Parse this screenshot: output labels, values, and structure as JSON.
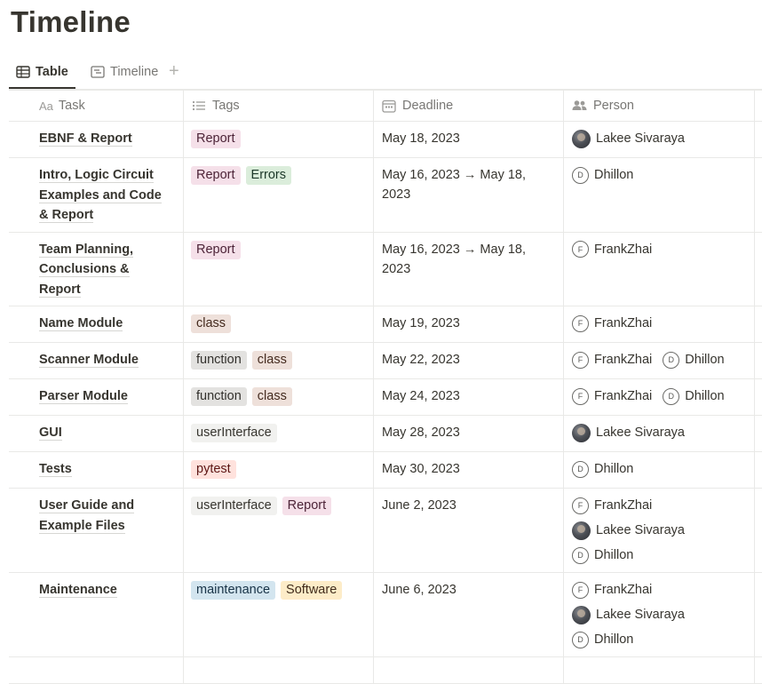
{
  "page": {
    "title": "Timeline"
  },
  "tabs": [
    {
      "label": "Table",
      "icon": "table-icon",
      "active": true
    },
    {
      "label": "Timeline",
      "icon": "timeline-icon",
      "active": false
    }
  ],
  "columns": {
    "task": {
      "label": "Task",
      "icon": "text-property-icon",
      "icon_text": "Aa"
    },
    "tags": {
      "label": "Tags",
      "icon": "multi-select-icon"
    },
    "deadline": {
      "label": "Deadline",
      "icon": "calendar-icon"
    },
    "person": {
      "label": "Person",
      "icon": "people-icon"
    }
  },
  "tag_colors": {
    "Report": {
      "bg": "#f5e0e9",
      "fg": "#4c2337"
    },
    "Errors": {
      "bg": "#dbeddb",
      "fg": "#1c3829"
    },
    "class": {
      "bg": "#eee0da",
      "fg": "#442a1e"
    },
    "function": {
      "bg": "#e3e2e0",
      "fg": "#32302c"
    },
    "userInterface": {
      "bg": "#f1f1ef",
      "fg": "#37352f"
    },
    "pytest": {
      "bg": "#ffe2dd",
      "fg": "#5d1715"
    },
    "maintenance": {
      "bg": "#d3e5ef",
      "fg": "#183347"
    },
    "Software": {
      "bg": "#fdecc8",
      "fg": "#402c1b"
    }
  },
  "rows": [
    {
      "task": "EBNF & Report",
      "tags": [
        "Report"
      ],
      "deadline": "May 18, 2023",
      "people": [
        {
          "name": "Lakee Sivaraya",
          "avatar": "photo"
        }
      ]
    },
    {
      "task": "Intro, Logic Circuit Examples and Code & Report",
      "tags": [
        "Report",
        "Errors"
      ],
      "deadline": "May 16, 2023 → May 18, 2023",
      "people": [
        {
          "name": "Dhillon",
          "avatar": "D"
        }
      ]
    },
    {
      "task": "Team Planning, Conclusions & Report",
      "tags": [
        "Report"
      ],
      "deadline": "May 16, 2023 → May 18, 2023",
      "people": [
        {
          "name": "FrankZhai",
          "avatar": "F"
        }
      ]
    },
    {
      "task": "Name Module",
      "tags": [
        "class"
      ],
      "deadline": "May 19, 2023",
      "people": [
        {
          "name": "FrankZhai",
          "avatar": "F"
        }
      ]
    },
    {
      "task": "Scanner Module",
      "tags": [
        "function",
        "class"
      ],
      "deadline": "May 22, 2023",
      "people": [
        {
          "name": "FrankZhai",
          "avatar": "F"
        },
        {
          "name": "Dhillon",
          "avatar": "D"
        }
      ]
    },
    {
      "task": "Parser Module",
      "tags": [
        "function",
        "class"
      ],
      "deadline": "May 24, 2023",
      "people": [
        {
          "name": "FrankZhai",
          "avatar": "F"
        },
        {
          "name": "Dhillon",
          "avatar": "D"
        }
      ]
    },
    {
      "task": "GUI",
      "tags": [
        "userInterface"
      ],
      "deadline": "May 28, 2023",
      "people": [
        {
          "name": "Lakee Sivaraya",
          "avatar": "photo"
        }
      ]
    },
    {
      "task": "Tests",
      "tags": [
        "pytest"
      ],
      "deadline": "May 30, 2023",
      "people": [
        {
          "name": "Dhillon",
          "avatar": "D"
        }
      ]
    },
    {
      "task": "User Guide and Example Files",
      "tags": [
        "userInterface",
        "Report"
      ],
      "deadline": "June 2, 2023",
      "people": [
        {
          "name": "FrankZhai",
          "avatar": "F"
        },
        {
          "name": "Lakee Sivaraya",
          "avatar": "photo"
        },
        {
          "name": "Dhillon",
          "avatar": "D"
        }
      ]
    },
    {
      "task": "Maintenance",
      "tags": [
        "maintenance",
        "Software"
      ],
      "deadline": "June 6, 2023",
      "people": [
        {
          "name": "FrankZhai",
          "avatar": "F"
        },
        {
          "name": "Lakee Sivaraya",
          "avatar": "photo"
        },
        {
          "name": "Dhillon",
          "avatar": "D"
        }
      ]
    }
  ]
}
